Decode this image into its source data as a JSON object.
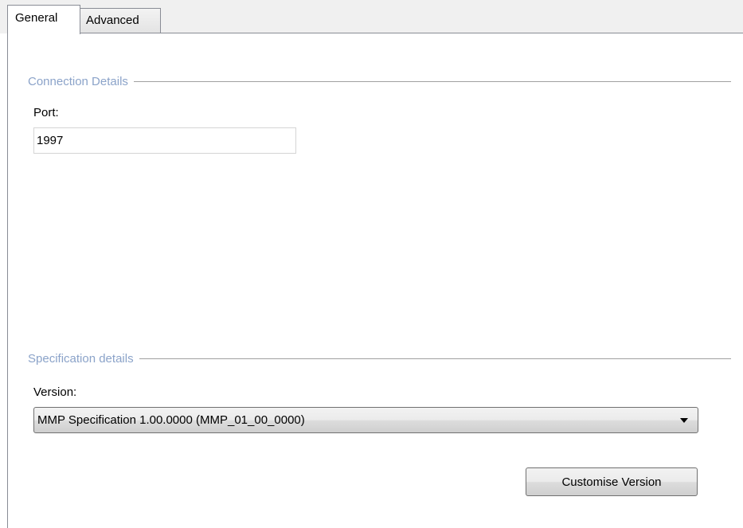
{
  "tabs": [
    {
      "label": "General",
      "active": true
    },
    {
      "label": "Advanced",
      "active": false
    }
  ],
  "connection": {
    "header": "Connection Details",
    "port_label": "Port:",
    "port_value": "1997"
  },
  "specification": {
    "header": "Specification details",
    "version_label": "Version:",
    "version_value": "MMP Specification 1.00.0000 (MMP_01_00_0000)",
    "customise_button": "Customise Version"
  },
  "colors": {
    "group_header_text": "#8ba3c9",
    "border": "#898c95"
  },
  "icons": {
    "dropdown_arrow": "chevron-down-icon"
  }
}
